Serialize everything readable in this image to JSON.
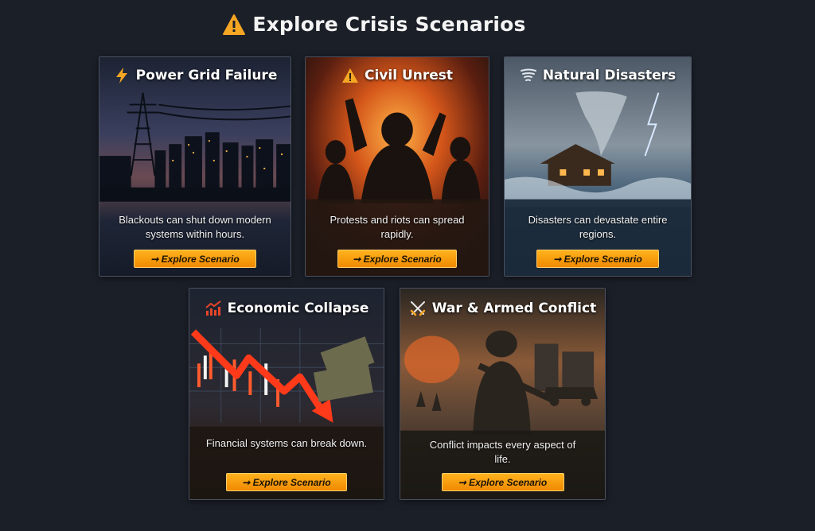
{
  "page": {
    "heading": "Explore Crisis Scenarios",
    "heading_icon": "warning-icon"
  },
  "cards": [
    {
      "title": "Power Grid Failure",
      "icon": "lightning-icon",
      "description": "Blackouts can shut down modern systems within hours.",
      "button": "➞ Explore Scenario"
    },
    {
      "title": "Civil Unrest",
      "icon": "warning-icon",
      "description": "Protests and riots can spread rapidly.",
      "button": "➞ Explore Scenario"
    },
    {
      "title": "Natural Disasters",
      "icon": "tornado-icon",
      "description": "Disasters can devastate entire regions.",
      "button": "➞ Explore Scenario"
    },
    {
      "title": "Economic Collapse",
      "icon": "chart-down-icon",
      "description": "Financial systems can break down.",
      "button": "➞ Explore Scenario"
    },
    {
      "title": "War & Armed Conflict",
      "icon": "crossed-swords-icon",
      "description": "Conflict impacts every aspect of life.",
      "button": "➞ Explore Scenario"
    }
  ],
  "colors": {
    "background": "#1b1f27",
    "button": "#f5a00e",
    "accent_warning": "#f5a623"
  }
}
